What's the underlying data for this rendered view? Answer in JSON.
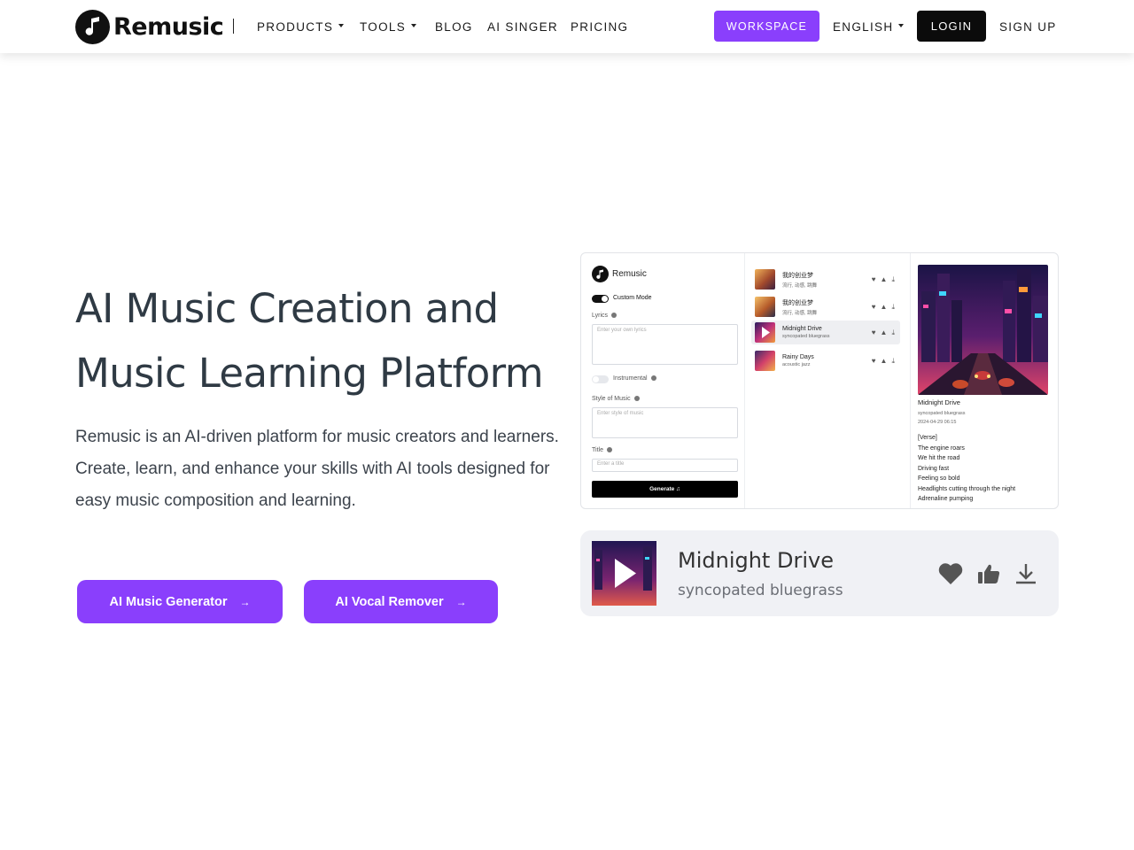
{
  "brand": {
    "name": "Remusic"
  },
  "nav": {
    "products": "PRODUCTS",
    "tools": "TOOLS",
    "blog": "BLOG",
    "ai_singer": "AI SINGER",
    "pricing": "PRICING",
    "workspace": "WORKSPACE",
    "language": "ENGLISH",
    "login": "LOGIN",
    "signup": "SIGN UP"
  },
  "hero": {
    "title_line1": "AI Music Creation and",
    "title_line2": "Music Learning Platform",
    "description": "Remusic is an AI-driven platform for music creators and learners. Create, learn, and enhance your skills with AI tools designed for easy music composition and learning.",
    "cta_primary": "AI Music Generator",
    "cta_secondary": "AI Vocal Remover"
  },
  "preview": {
    "app_name": "Remusic",
    "custom_mode": "Custom Mode",
    "lyrics_label": "Lyrics",
    "lyrics_placeholder": "Enter your own lyrics",
    "instrumental_label": "Instrumental",
    "style_label": "Style of Music",
    "style_placeholder": "Enter style of music",
    "title_label": "Title",
    "title_placeholder": "Enter a title",
    "generate_label": "Generate ♫",
    "songs": [
      {
        "title": "我的创业梦",
        "subtitle": "流行, 动感, 跳舞"
      },
      {
        "title": "我的创业梦",
        "subtitle": "流行, 动感, 跳舞"
      },
      {
        "title": "Midnight Drive",
        "subtitle": "syncopated bluegrass"
      },
      {
        "title": "Rainy Days",
        "subtitle": "acoustic jazz"
      }
    ],
    "detail": {
      "title": "Midnight Drive",
      "subtitle": "syncopated bluegrass",
      "date": "2024-04-29 06:15",
      "lyrics": [
        "[Verse]",
        "The engine roars",
        "We hit the road",
        "Driving fast",
        "Feeling so bold",
        "Headlights cutting through the night",
        "Adrenaline pumping"
      ]
    }
  },
  "player": {
    "title": "Midnight Drive",
    "subtitle": "syncopated bluegrass"
  },
  "colors": {
    "accent": "#8a3ffc",
    "dark": "#0b0b0b",
    "player_bg": "#f0f1f5"
  }
}
